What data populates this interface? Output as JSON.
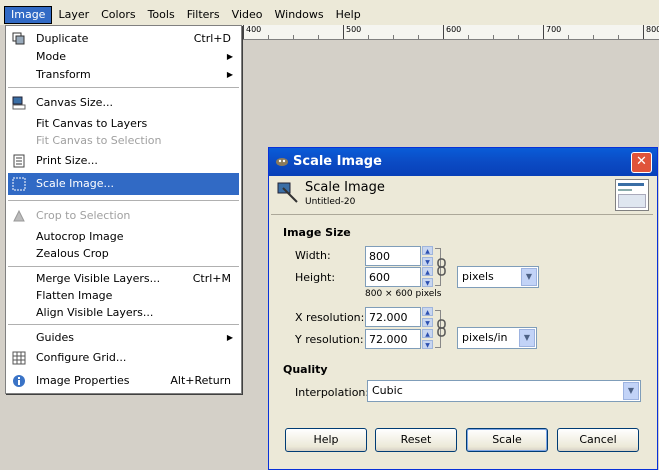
{
  "menubar": {
    "items": [
      {
        "label": "Image",
        "active": true
      },
      {
        "label": "Layer"
      },
      {
        "label": "Colors"
      },
      {
        "label": "Tools"
      },
      {
        "label": "Filters"
      },
      {
        "label": "Video"
      },
      {
        "label": "Windows"
      },
      {
        "label": "Help"
      }
    ]
  },
  "ruler": {
    "labels": [
      "400",
      "500",
      "600",
      "700",
      "800"
    ]
  },
  "image_menu": {
    "items": [
      {
        "label": "Duplicate",
        "shortcut": "Ctrl+D",
        "icon": "duplicate-icon"
      },
      {
        "label": "Mode",
        "submenu": true
      },
      {
        "label": "Transform",
        "submenu": true
      },
      {
        "label": "Canvas Size...",
        "icon": "canvas-size-icon"
      },
      {
        "label": "Fit Canvas to Layers"
      },
      {
        "label": "Fit Canvas to Selection",
        "disabled": true
      },
      {
        "label": "Print Size...",
        "icon": "print-icon"
      },
      {
        "label": "Scale Image...",
        "icon": "scale-icon",
        "highlighted": true
      },
      {
        "label": "Crop to Selection",
        "disabled": true,
        "icon": "crop-icon"
      },
      {
        "label": "Autocrop Image"
      },
      {
        "label": "Zealous Crop"
      },
      {
        "label": "Merge Visible Layers...",
        "shortcut": "Ctrl+M"
      },
      {
        "label": "Flatten Image"
      },
      {
        "label": "Align Visible Layers..."
      },
      {
        "label": "Guides",
        "submenu": true
      },
      {
        "label": "Configure Grid...",
        "icon": "grid-icon"
      },
      {
        "label": "Image Properties",
        "shortcut": "Alt+Return",
        "icon": "info-icon"
      }
    ]
  },
  "dialog": {
    "title": "Scale Image",
    "header_title": "Scale Image",
    "header_subtitle": "Untitled-20",
    "image_size_section": "Image Size",
    "width_label": "Width:",
    "width_value": "800",
    "height_label": "Height:",
    "height_value": "600",
    "size_unit": "pixels",
    "size_caption": "800 × 600 pixels",
    "xres_label": "X resolution:",
    "xres_value": "72.000",
    "yres_label": "Y resolution:",
    "yres_value": "72.000",
    "res_unit": "pixels/in",
    "quality_section": "Quality",
    "interp_label": "Interpolation:",
    "interp_value": "Cubic",
    "buttons": {
      "help": "Help",
      "reset": "Reset",
      "scale": "Scale",
      "cancel": "Cancel"
    }
  },
  "colors": {
    "menu_highlight": "#316ac5",
    "titlebar": "#0b4bc4",
    "dialog_bg": "#ece9d8"
  }
}
